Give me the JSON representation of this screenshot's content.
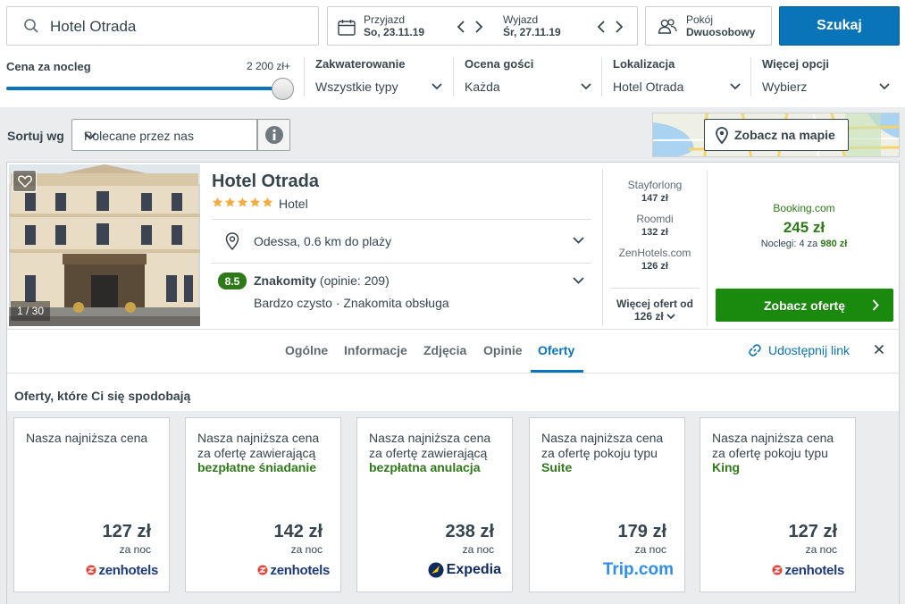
{
  "search": {
    "query": "Hotel Otrada"
  },
  "dates": {
    "checkin_label": "Przyjazd",
    "checkin_value": "So, 23.11.19",
    "checkout_label": "Wyjazd",
    "checkout_value": "Śr, 27.11.19"
  },
  "room": {
    "label": "Pokój",
    "value": "Dwuosobowy"
  },
  "search_button": "Szukaj",
  "filters": {
    "price_label": "Cena za nocleg",
    "price_max": "2 200 zł+",
    "price_fill": 1.0,
    "accommodation": {
      "title": "Zakwaterowanie",
      "value": "Wszystkie typy"
    },
    "rating": {
      "title": "Ocena gości",
      "value": "Każda"
    },
    "location": {
      "title": "Lokalizacja",
      "value": "Hotel Otrada"
    },
    "more": {
      "title": "Więcej opcji",
      "value": "Wybierz"
    }
  },
  "sort": {
    "label": "Sortuj wg",
    "value": "Polecane przez nas"
  },
  "map_button": "Zobacz na mapie",
  "hotel": {
    "name": "Hotel Otrada",
    "stars": 5,
    "type": "Hotel",
    "photo_counter": "1 / 30",
    "location": "Odessa, 0.6 km do plaży",
    "rating_score": "8.5",
    "rating_word": "Znakomity",
    "rating_count": "(opinie: 209)",
    "rating_summary": "Bardzo czysto · Znakomita obsługa",
    "alt_deals": [
      {
        "provider": "Stayforlong",
        "price": "147 zł"
      },
      {
        "provider": "Roomdi",
        "price": "132 zł"
      },
      {
        "provider": "ZenHotels.com",
        "price": "126 zł"
      }
    ],
    "more_deals_label": "Więcej ofert od",
    "more_deals_price": "126 zł",
    "best_provider": "Booking.com",
    "best_price": "245 zł",
    "nights_text": "Noclegi: 4 za",
    "nights_total": "980 zł",
    "view_deal": "Zobacz ofertę"
  },
  "tabs": [
    {
      "label": "Ogólne"
    },
    {
      "label": "Informacje"
    },
    {
      "label": "Zdjęcia"
    },
    {
      "label": "Opinie"
    },
    {
      "label": "Oferty",
      "active": true
    }
  ],
  "share_label": "Udostępnij link",
  "offers_heading": "Oferty, które Ci się spodobają",
  "offers": [
    {
      "line1": "Nasza najniższa cena",
      "line2": "",
      "highlight": "",
      "price": "127 zł",
      "per": "za noc",
      "provider": "zenhotels"
    },
    {
      "line1": "Nasza najniższa cena",
      "line2": "za ofertę zawierającą",
      "highlight": "bezpłatne śniadanie",
      "price": "142 zł",
      "per": "za noc",
      "provider": "zenhotels"
    },
    {
      "line1": "Nasza najniższa cena",
      "line2": "za ofertę zawierającą",
      "highlight": "bezpłatna anulacja",
      "price": "238 zł",
      "per": "za noc",
      "provider": "Expedia"
    },
    {
      "line1": "Nasza najniższa cena",
      "line2": "za ofertę pokoju typu",
      "highlight": "Suite",
      "price": "179 zł",
      "per": "za noc",
      "provider": "Trip.com"
    },
    {
      "line1": "Nasza najniższa cena",
      "line2": "za ofertę pokoju typu",
      "highlight": "King",
      "price": "127 zł",
      "per": "za noc",
      "provider": "zenhotels"
    }
  ],
  "colors": {
    "accent_blue": "#0a74b8",
    "deal_green": "#1a8a0f",
    "text_green": "#2f7a18",
    "star_yellow": "#f6ab3f"
  }
}
